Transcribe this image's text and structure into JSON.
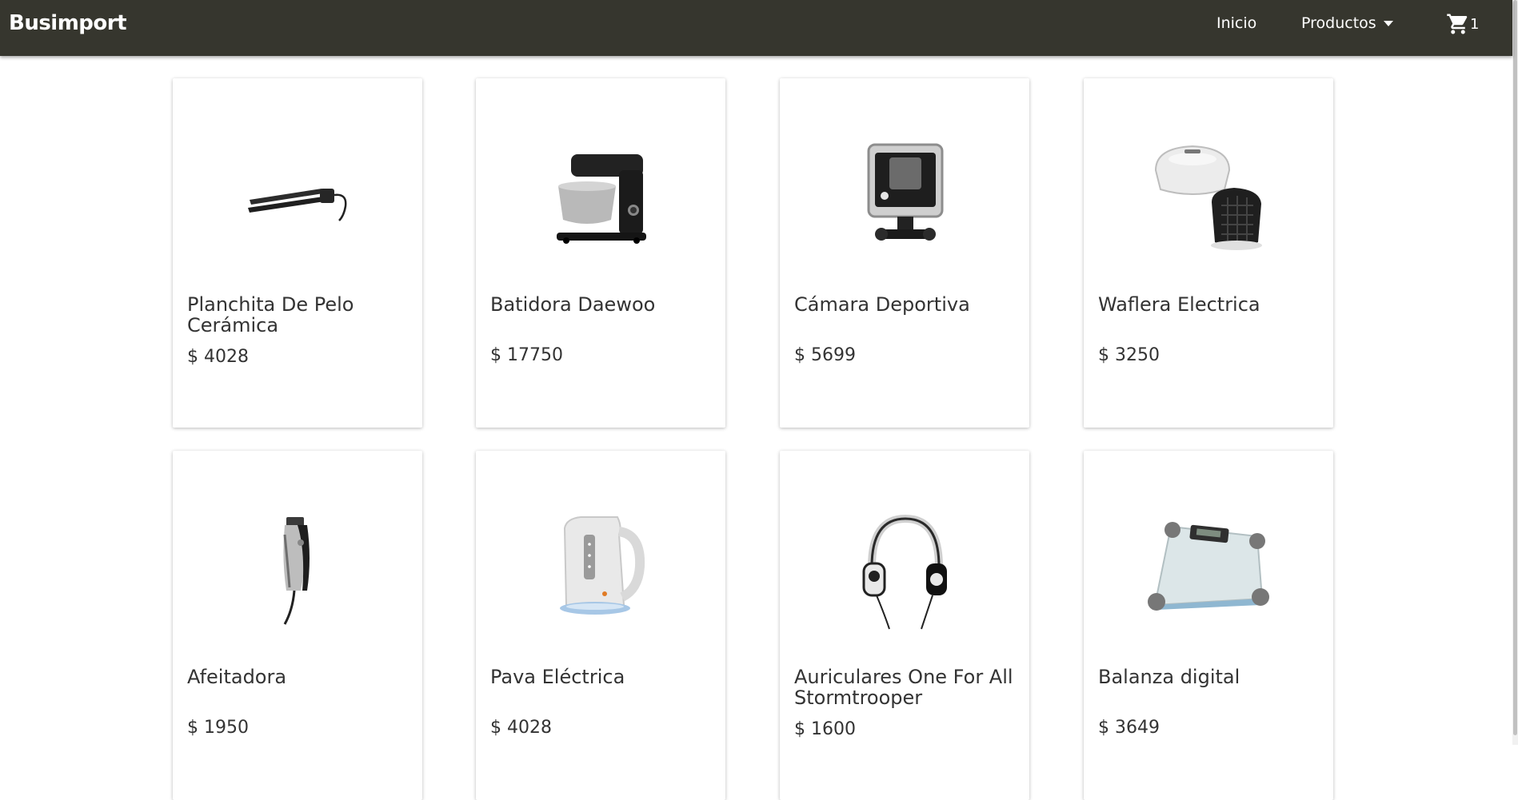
{
  "navbar": {
    "brand": "Busimport",
    "links": [
      {
        "label": "Inicio"
      },
      {
        "label": "Productos"
      }
    ],
    "cart": {
      "icon": "cart-icon",
      "count": "1"
    }
  },
  "products": [
    {
      "title": "Planchita De Pelo Cerámica",
      "price": "$ 4028",
      "image": "hair-straightener"
    },
    {
      "title": "Batidora Daewoo",
      "price": "$ 17750",
      "image": "stand-mixer"
    },
    {
      "title": "Cámara Deportiva",
      "price": "$ 5699",
      "image": "action-camera"
    },
    {
      "title": "Waflera Electrica",
      "price": "$ 3250",
      "image": "waffle-maker"
    },
    {
      "title": "Afeitadora",
      "price": "$ 1950",
      "image": "hair-clipper"
    },
    {
      "title": "Pava Eléctrica",
      "price": "$ 4028",
      "image": "electric-kettle"
    },
    {
      "title": "Auriculares One For All Stormtrooper",
      "price": "$ 1600",
      "image": "headphones"
    },
    {
      "title": "Balanza digital",
      "price": "$ 3649",
      "image": "bathroom-scale"
    }
  ]
}
